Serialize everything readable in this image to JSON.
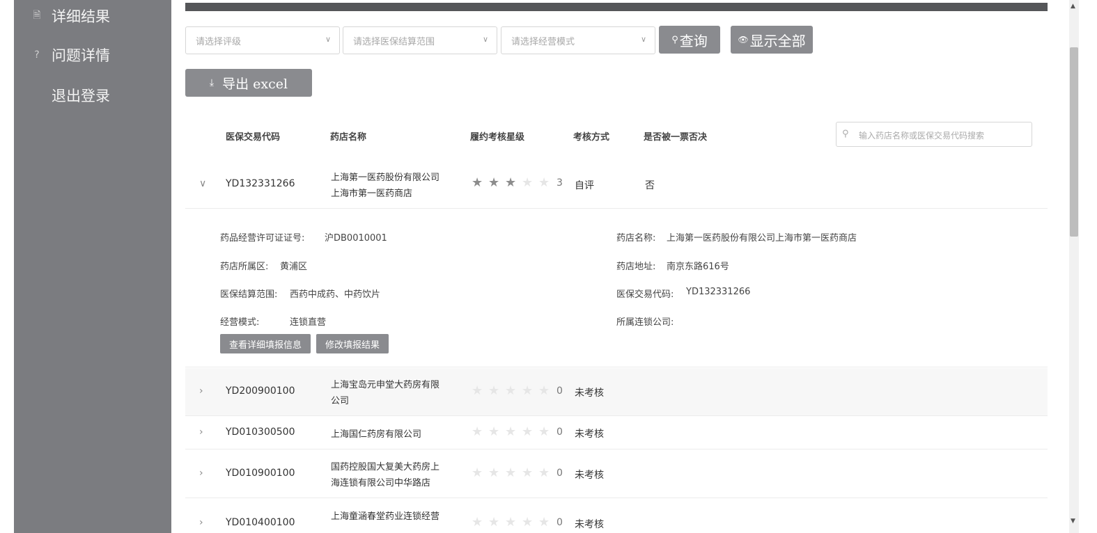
{
  "sidebar": {
    "items": [
      {
        "label": "详细结果",
        "icon": "document-icon",
        "glyph": "🗎"
      },
      {
        "label": "问题详情",
        "icon": "question-icon",
        "glyph": "?"
      },
      {
        "label": "退出登录",
        "icon": "",
        "glyph": ""
      }
    ]
  },
  "filters": {
    "rating_placeholder": "请选择评级",
    "scope_placeholder": "请选择医保结算范围",
    "mode_placeholder": "请选择经营模式",
    "query_label": "查询",
    "show_all_label": "显示全部",
    "export_label": "导出 excel"
  },
  "table": {
    "headers": [
      "医保交易代码",
      "药店名称",
      "履约考核星级",
      "考核方式",
      "是否被一票否决"
    ],
    "search_placeholder": "输入药店名称或医保交易代码搜索",
    "rows": [
      {
        "code": "YD132331266",
        "name_line1": "上海第一医药股份有限公司",
        "name_line2": "上海市第一医药商店",
        "stars": 3,
        "star_label": "3",
        "method": "自评",
        "veto": "否",
        "expanded": true
      },
      {
        "code": "YD200900100",
        "name_line1": "上海宝岛元申堂大药房有限",
        "name_line2": "公司",
        "stars": 0,
        "star_label": "0",
        "method": "未考核",
        "veto": ""
      },
      {
        "code": "YD010300500",
        "name_line1": "上海国仁药房有限公司",
        "name_line2": "",
        "stars": 0,
        "star_label": "0",
        "method": "未考核",
        "veto": ""
      },
      {
        "code": "YD010900100",
        "name_line1": "国药控股国大复美大药房上",
        "name_line2": "海连锁有限公司中华路店",
        "stars": 0,
        "star_label": "0",
        "method": "未考核",
        "veto": ""
      },
      {
        "code": "YD010400100",
        "name_line1": "上海童涵春堂药业连锁经营",
        "name_line2": "",
        "stars": 0,
        "star_label": "0",
        "method": "未考核",
        "veto": ""
      }
    ]
  },
  "detail": {
    "license_label": "药品经营许可证证号:",
    "license_value": "沪DB0010001",
    "district_label": "药店所属区:",
    "district_value": "黄浦区",
    "scope_label": "医保结算范围:",
    "scope_value": "西药中成药、中药饮片",
    "mode_label": "经营模式:",
    "mode_value": "连锁直营",
    "store_name_label": "药店名称:",
    "store_name_value": "上海第一医药股份有限公司上海市第一医药商店",
    "address_label": "药店地址:",
    "address_value": "南京东路616号",
    "code_label": "医保交易代码:",
    "code_value": "YD132331266",
    "chain_label": "所属连锁公司:",
    "view_button": "查看详细填报信息",
    "edit_button": "修改填报结果"
  },
  "colors": {
    "sidebar_bg": "#7b7c80",
    "button_bg": "#8a8b8f",
    "star_on": "#8c8c8c",
    "star_off": "#e6e6e6"
  }
}
